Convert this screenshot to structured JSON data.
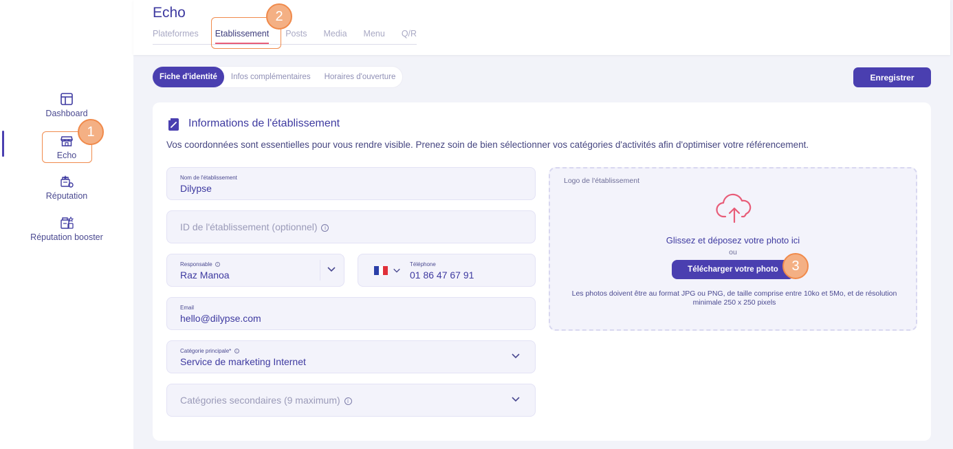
{
  "sidebar": {
    "items": [
      {
        "label": "Dashboard",
        "icon": "dashboard-icon"
      },
      {
        "label": "Echo",
        "icon": "store-icon"
      },
      {
        "label": "Réputation",
        "icon": "reputation-icon"
      },
      {
        "label": "Réputation booster",
        "icon": "reputation-booster-icon"
      }
    ],
    "active": "Echo"
  },
  "header": {
    "title": "Echo",
    "tabs": [
      {
        "label": "Plateformes"
      },
      {
        "label": "Etablissement"
      },
      {
        "label": "Posts"
      },
      {
        "label": "Media"
      },
      {
        "label": "Menu"
      },
      {
        "label": "Q/R"
      }
    ],
    "active_tab": "Etablissement"
  },
  "subtabs": {
    "items": [
      {
        "label": "Fiche d'identité"
      },
      {
        "label": "Infos complémentaires"
      },
      {
        "label": "Horaires d'ouverture"
      }
    ],
    "active": "Fiche d'identité"
  },
  "actions": {
    "save_label": "Enregistrer"
  },
  "card": {
    "title": "Informations de l'établissement",
    "description": "Vos coordonnées sont essentielles pour vous rendre visible. Prenez soin de bien sélectionner vos catégories d'activités afin d'optimiser votre référencement.",
    "fields": {
      "name": {
        "label": "Nom de l'établissement",
        "value": "Dilypse"
      },
      "id": {
        "placeholder": "ID de l'établissement (optionnel)"
      },
      "responsable": {
        "label": "Responsable",
        "value": "Raz Manoa"
      },
      "phone": {
        "label": "Téléphone",
        "value": "01 86 47 67 91",
        "country": "FR"
      },
      "email": {
        "label": "Email",
        "value": "hello@dilypse.com"
      },
      "main_category": {
        "label": "Catégorie principale*",
        "value": "Service de marketing Internet"
      },
      "secondary_categories": {
        "placeholder": "Catégories secondaires (9 maximum)"
      }
    },
    "upload": {
      "label": "Logo de l'établissement",
      "hint": "Glissez et déposez votre photo ici",
      "or": "ou",
      "button_label": "Télécharger votre photo",
      "note": "Les photos doivent être au format JPG ou PNG, de taille comprise entre 10ko et 5Mo, et de résolution minimale 250 x 250 pixels"
    }
  },
  "annotations": [
    "1",
    "2",
    "3"
  ],
  "colors": {
    "accent": "#4a3fb0",
    "annotation": "#f08a4b",
    "tab_underline": "#e85c78",
    "cloud_icon": "#e85c78"
  }
}
